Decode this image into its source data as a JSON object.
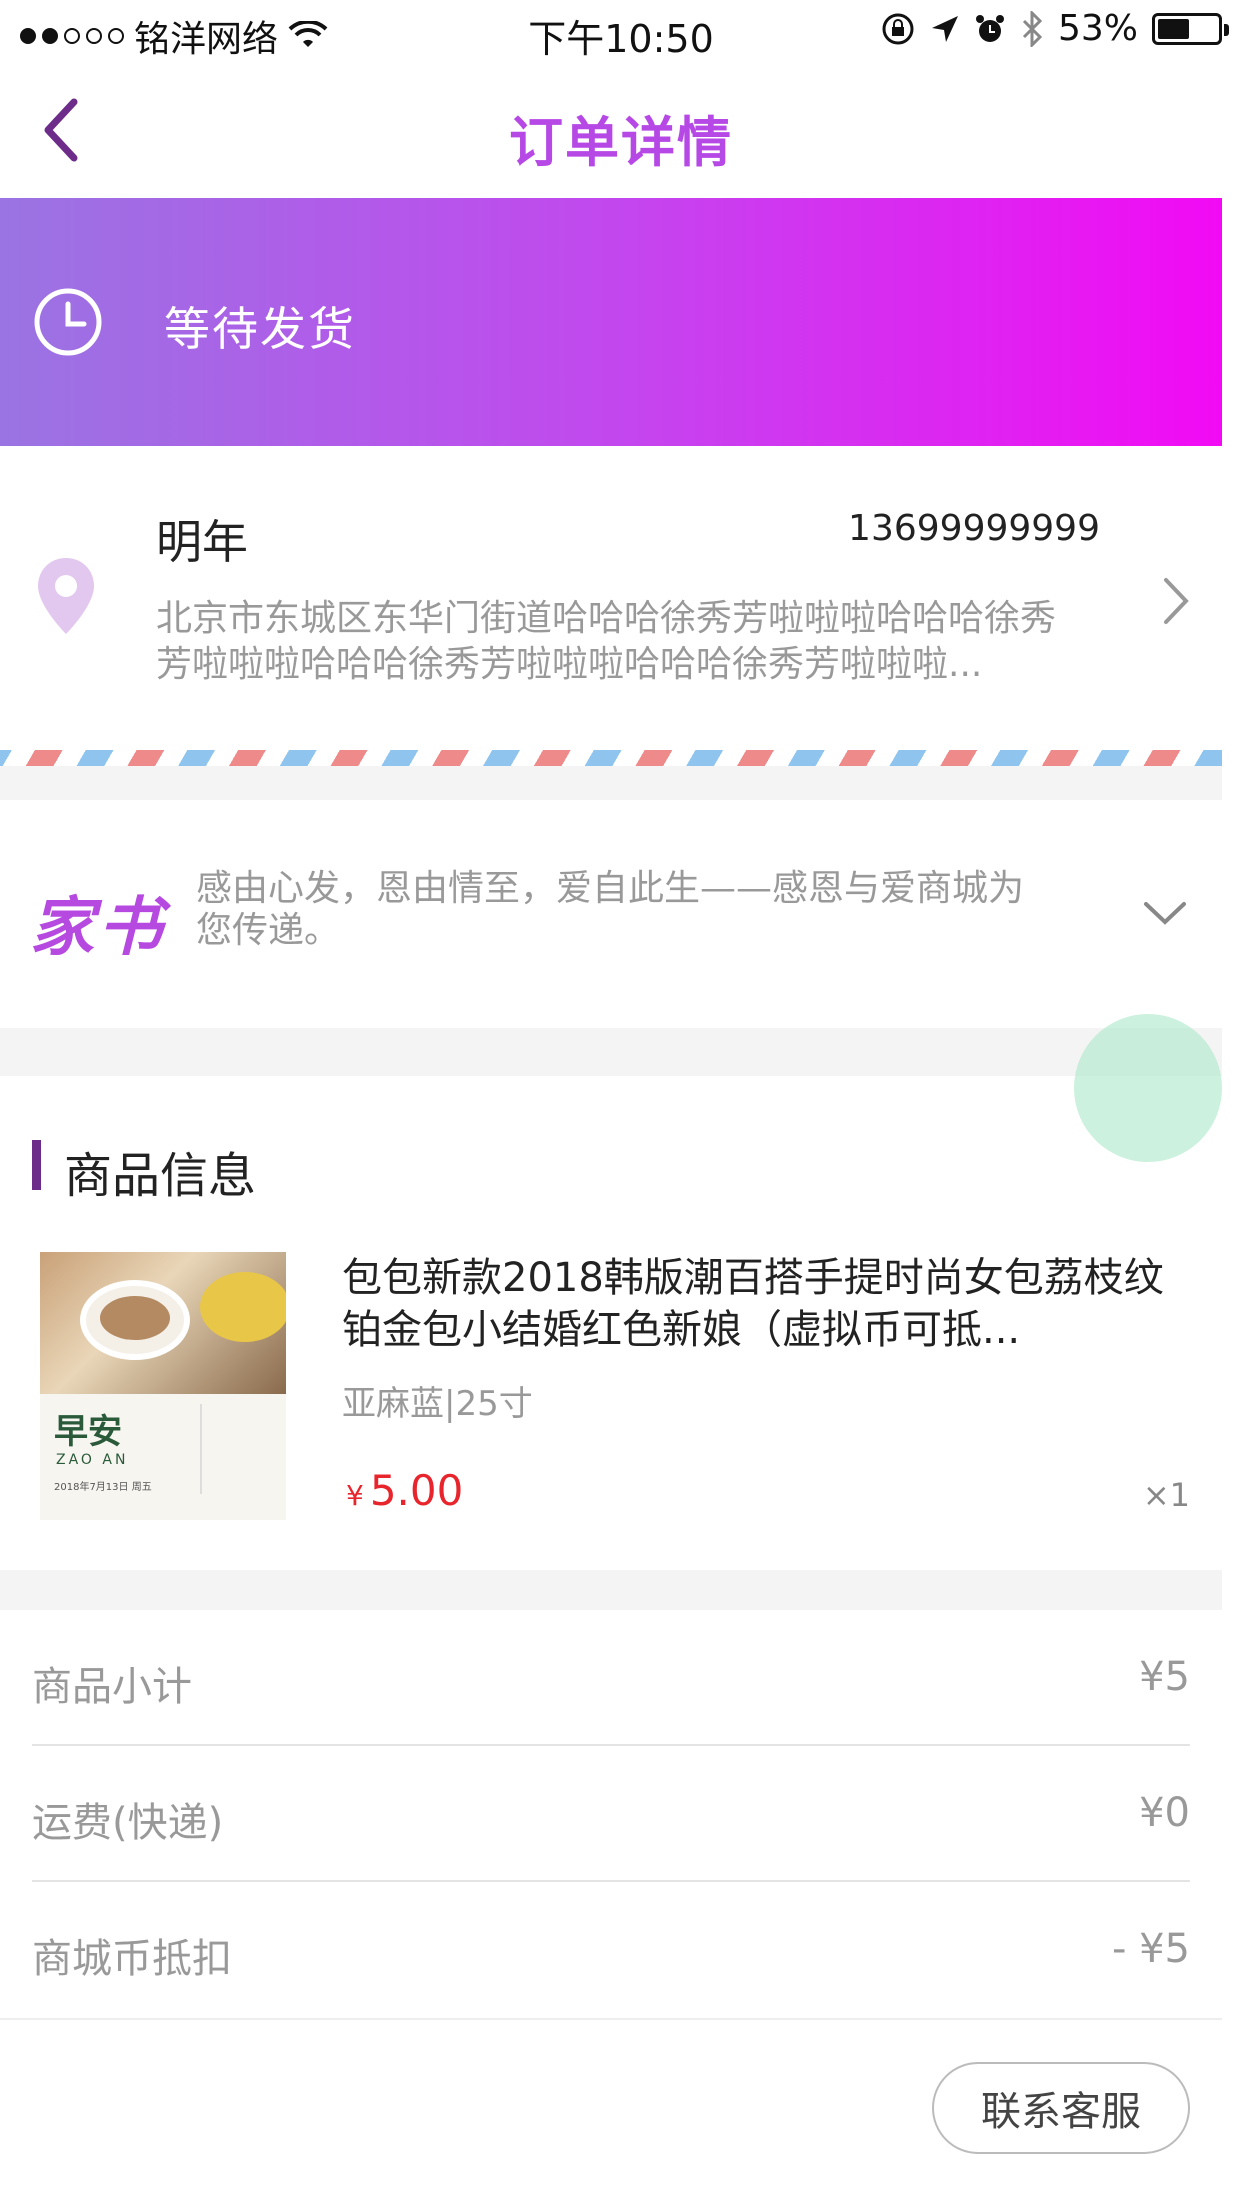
{
  "status_bar": {
    "carrier": "铭洋网络",
    "time": "下午10:50",
    "battery": "53%",
    "battery_level": 0.53
  },
  "nav": {
    "title": "订单详情"
  },
  "order_status": {
    "text": "等待发货",
    "gradient_colors": [
      "#9a74e2",
      "#f20af4"
    ]
  },
  "address": {
    "name": "明年",
    "phone": "13699999999",
    "detail": "北京市东城区东华门街道哈哈哈徐秀芳啦啦啦哈哈哈徐秀芳啦啦啦哈哈哈徐秀芳啦啦啦哈哈哈徐秀芳啦啦啦..."
  },
  "letter": {
    "logo": "家书",
    "message": "感由心发，恩由情至，爱自此生——感恩与爱商城为您传递。"
  },
  "goods": {
    "section_title": "商品信息",
    "items": [
      {
        "name": "包包新款2018韩版潮百搭手提时尚女包荔枝纹铂金包小结婚红色新娘（虚拟币可抵...",
        "spec": "亚麻蓝|25寸",
        "currency": "¥",
        "price": "5.00",
        "qty": "×1",
        "thumb_title": "早安",
        "thumb_sub": "ZAO AN",
        "thumb_date": "2018年7月13日 周五"
      }
    ]
  },
  "summary": [
    {
      "label": "商品小计",
      "value": "¥5"
    },
    {
      "label": "运费(快递)",
      "value": "¥0"
    },
    {
      "label": "商城币抵扣",
      "value": "- ¥5"
    }
  ],
  "bottom": {
    "contact_button": "联系客服"
  },
  "colors": {
    "accent": "#b648e6",
    "price": "#e8252c"
  }
}
